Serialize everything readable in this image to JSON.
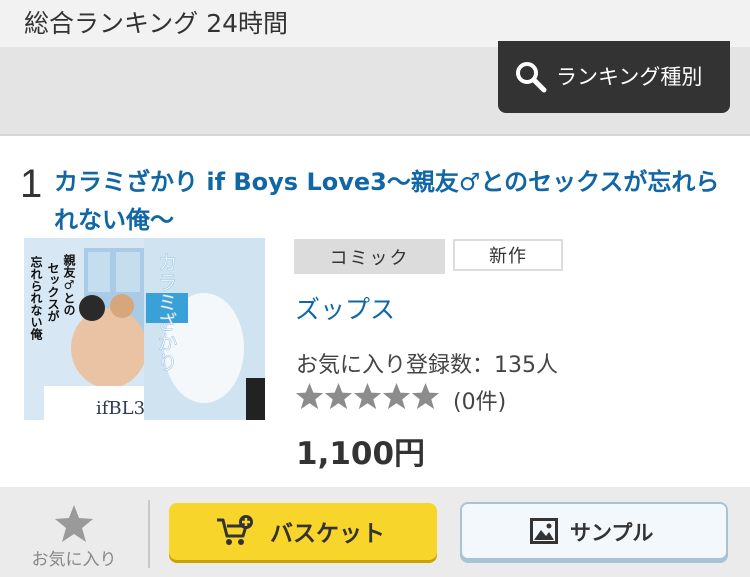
{
  "header": {
    "title": "総合ランキング 24時間",
    "ranking_type_button": "ランキング種別"
  },
  "item": {
    "rank": "1",
    "title": "カラミざかり if Boys Love3〜親友♂とのセックスが忘れられない俺〜",
    "cover": {
      "lines": [
        "親友♂との",
        "セックスが",
        "忘れられない俺"
      ],
      "vertical_title": "カラミざかり",
      "logo_text": "ifBL3",
      "colors": {
        "sky": "#9ec7e6",
        "accent": "#3aa0d8"
      }
    },
    "tags": {
      "category": "コミック",
      "new": "新作"
    },
    "author": "ズップス",
    "favorite_count": "お気に入り登録数：135人",
    "rating": {
      "stars": 0,
      "max": 5
    },
    "review_count": "(0件)",
    "price": "1,100円"
  },
  "actions": {
    "favorite_label": "お気に入り",
    "basket_label": "バスケット",
    "sample_label": "サンプル"
  },
  "colors": {
    "link": "#1167a6",
    "basket": "#f8d52a",
    "star_empty": "#8c8c8c"
  }
}
